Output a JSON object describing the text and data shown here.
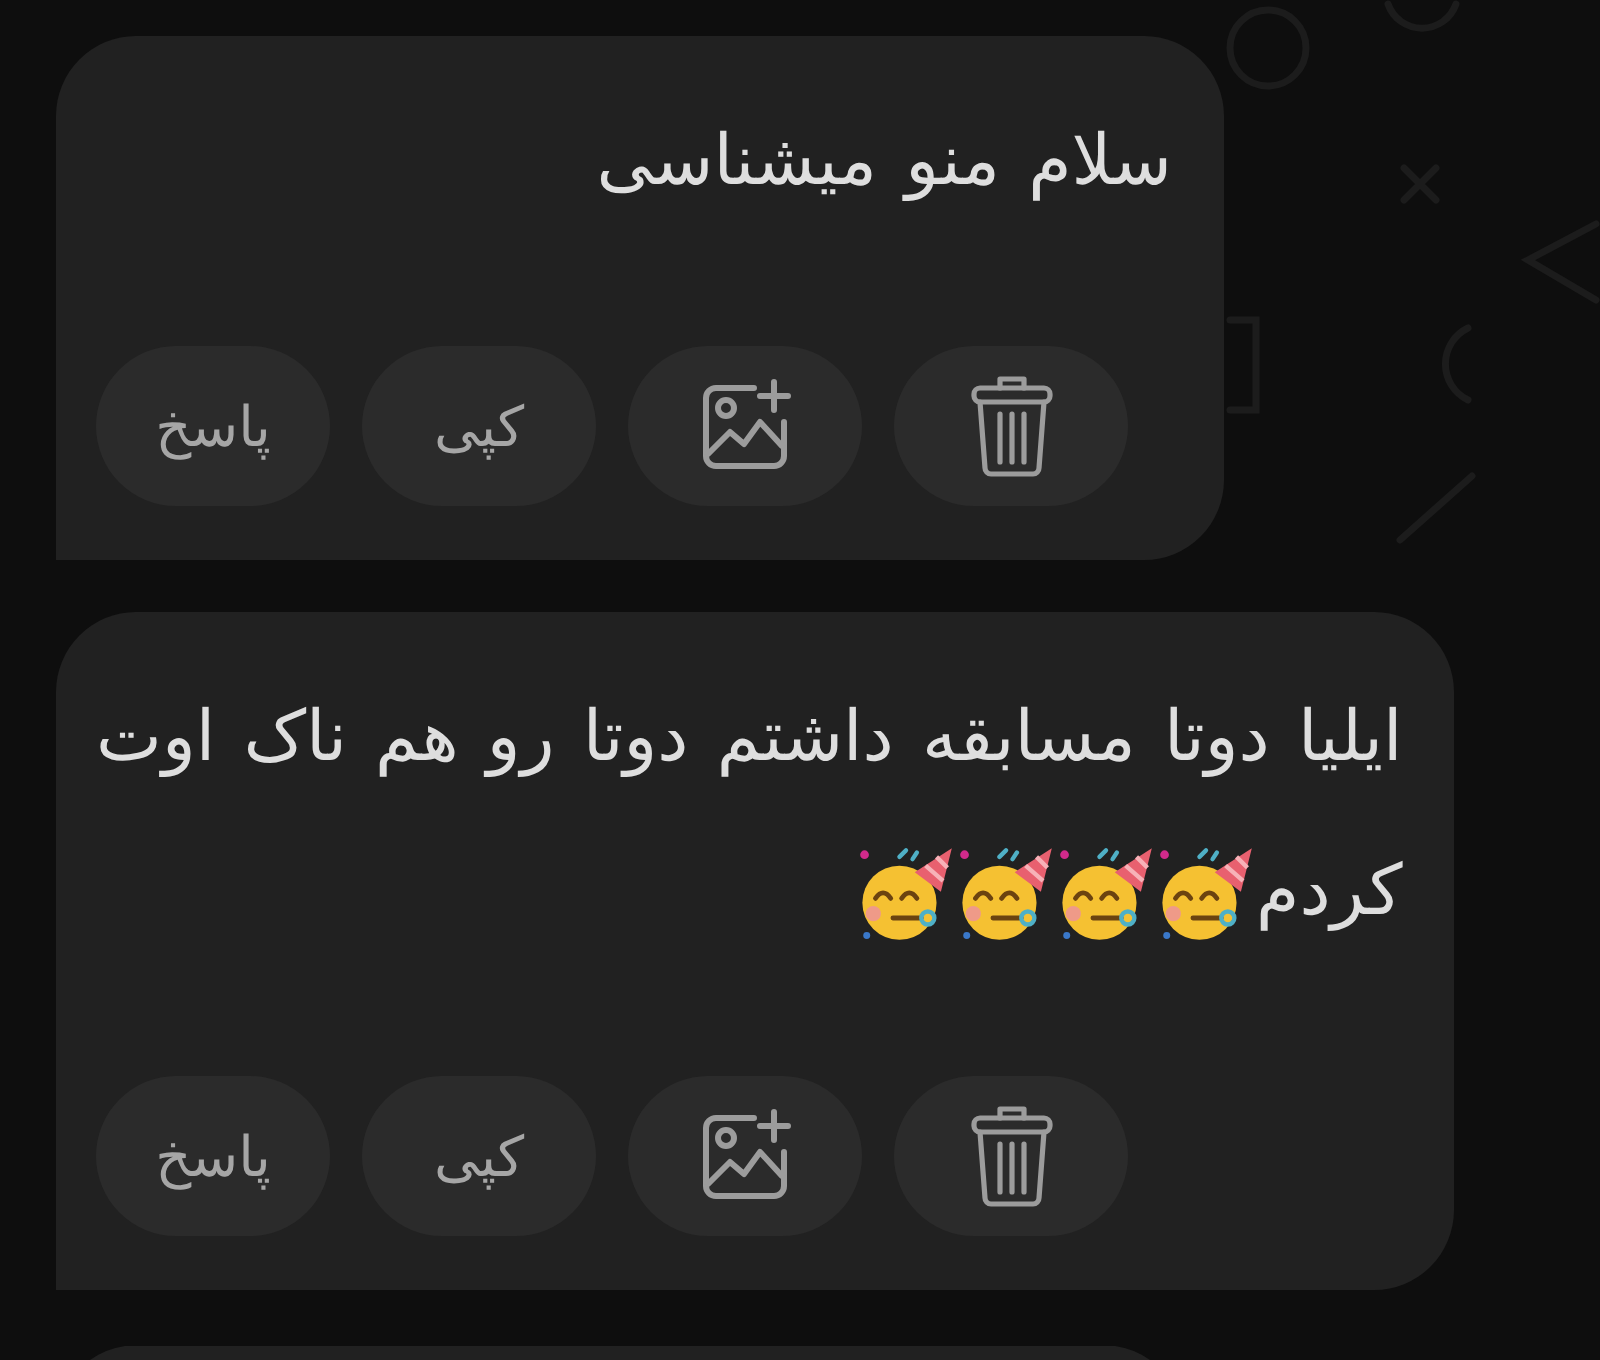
{
  "messages": [
    {
      "kind": "full",
      "lines": [
        {
          "text": "سلام منو میشناسی"
        }
      ],
      "actions": [
        {
          "kind": "delete"
        },
        {
          "kind": "add-image"
        },
        {
          "kind": "copy",
          "label": "کپی"
        },
        {
          "kind": "reply",
          "label": "پاسخ"
        }
      ]
    },
    {
      "kind": "full",
      "lines": [
        {
          "text": "ایلیا دوتا مسابقه داشتم دوتا رو هم ناک اوت"
        },
        {
          "text": "کردم",
          "emojis": [
            {
              "kind": "partying-face"
            },
            {
              "kind": "partying-face"
            },
            {
              "kind": "partying-face"
            },
            {
              "kind": "partying-face"
            }
          ]
        }
      ],
      "actions": [
        {
          "kind": "delete"
        },
        {
          "kind": "add-image"
        },
        {
          "kind": "copy",
          "label": "کپی"
        },
        {
          "kind": "reply",
          "label": "پاسخ"
        }
      ]
    },
    {
      "kind": "clipped"
    }
  ]
}
